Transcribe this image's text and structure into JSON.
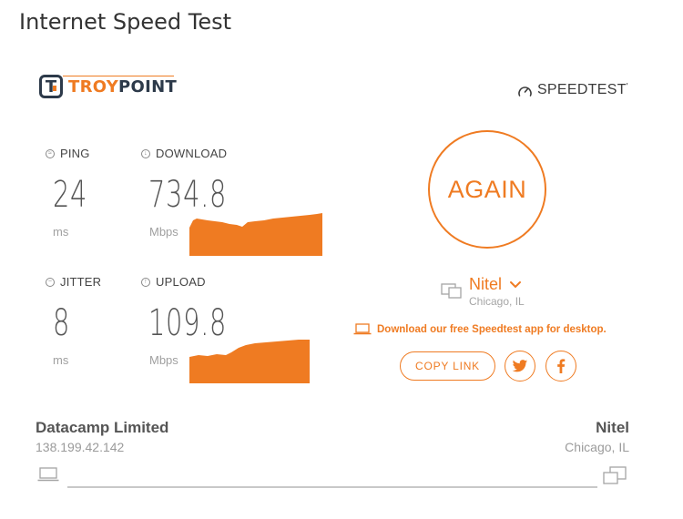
{
  "page": {
    "title": "Internet Speed Test"
  },
  "logo": {
    "mark": "T",
    "text_primary": "TROY",
    "text_secondary": "POINT"
  },
  "brand": {
    "label": "SPEEDTEST",
    "trademark": "'",
    "icon": "gauge-icon"
  },
  "metrics": {
    "ping": {
      "label": "PING",
      "value": "24",
      "unit": "ms",
      "icon": "ping-icon"
    },
    "download": {
      "label": "DOWNLOAD",
      "value": "734.8",
      "unit": "Mbps",
      "icon": "download-arrow-icon"
    },
    "jitter": {
      "label": "JITTER",
      "value": "8",
      "unit": "ms",
      "icon": "jitter-icon"
    },
    "upload": {
      "label": "UPLOAD",
      "value": "109.8",
      "unit": "Mbps",
      "icon": "upload-arrow-icon"
    }
  },
  "actions": {
    "again_label": "AGAIN",
    "copy_link_label": "COPY LINK",
    "twitter_icon": "twitter-icon",
    "facebook_icon": "facebook-icon"
  },
  "server": {
    "name": "Nitel",
    "location": "Chicago, IL",
    "icon": "server-icon",
    "dropdown_icon": "chevron-down-icon"
  },
  "promo": {
    "text": "Download our free Speedtest app for desktop.",
    "icon": "laptop-icon"
  },
  "footer": {
    "isp_name": "Datacamp Limited",
    "isp_ip": "138.199.42.142",
    "server_name": "Nitel",
    "server_location": "Chicago, IL"
  },
  "colors": {
    "accent": "#ef7b22",
    "text_dark": "#333333",
    "text_muted": "#a0a0a0"
  }
}
